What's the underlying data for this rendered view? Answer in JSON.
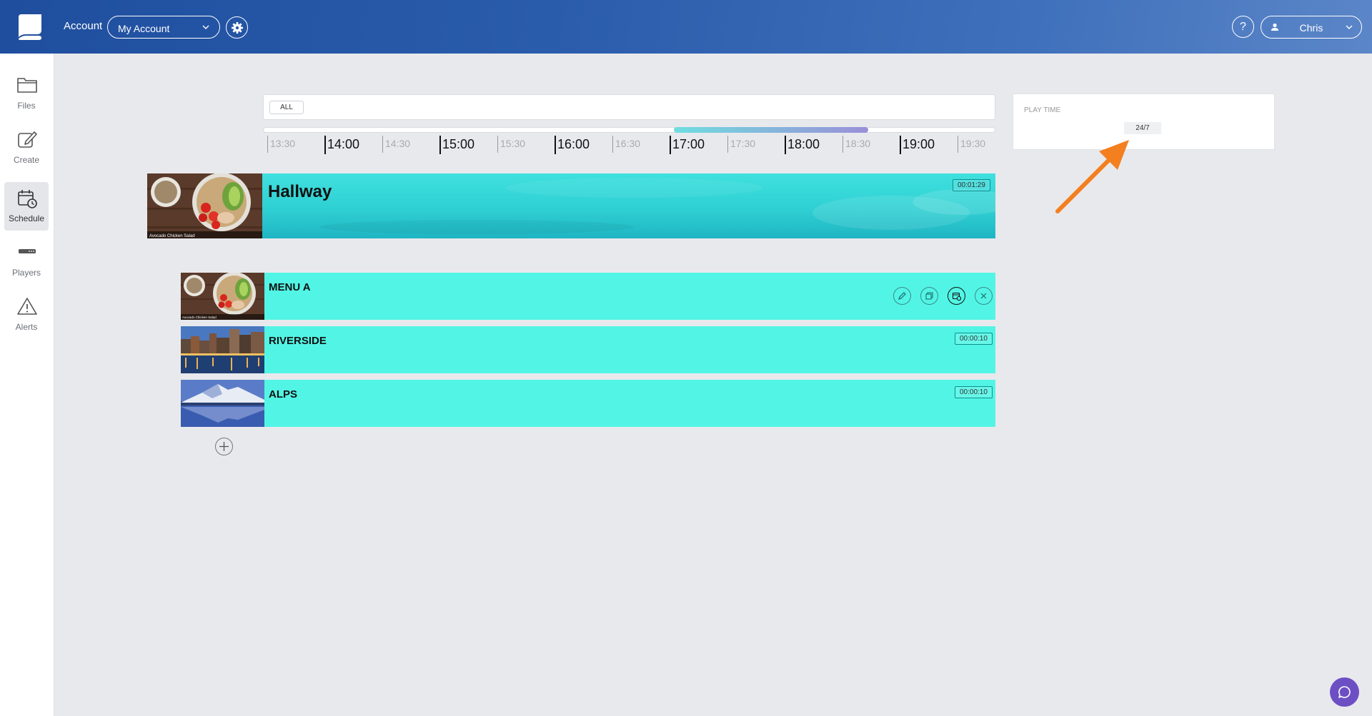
{
  "header": {
    "account_label": "Account",
    "account_select": "My Account",
    "help_label": "?",
    "user_name": "Chris"
  },
  "sidebar": {
    "items": [
      {
        "label": "Files",
        "icon": "folder-icon"
      },
      {
        "label": "Create",
        "icon": "edit-square-icon"
      },
      {
        "label": "Schedule",
        "icon": "calendar-clock-icon",
        "active": true
      },
      {
        "label": "Players",
        "icon": "player-device-icon"
      },
      {
        "label": "Alerts",
        "icon": "warning-icon"
      }
    ]
  },
  "filter": {
    "chip": "ALL"
  },
  "timeline": {
    "ticks": [
      "13:30",
      "14:00",
      "14:30",
      "15:00",
      "15:30",
      "16:00",
      "16:30",
      "17:00",
      "17:30",
      "18:00",
      "18:30",
      "19:00",
      "19:30"
    ],
    "selected_range": [
      "17:00",
      "18:25"
    ]
  },
  "play_time": {
    "label": "PLAY TIME",
    "value": "24/7"
  },
  "playlist": {
    "title": "Hallway",
    "duration": "00:01:29",
    "thumb_caption": "Avocado Chicken Salad",
    "items": [
      {
        "title": "MENU A",
        "duration": "",
        "thumb": "salad",
        "thumb_caption": "Avocado Chicken Salad"
      },
      {
        "title": "RIVERSIDE",
        "duration": "00:00:10",
        "thumb": "city-river"
      },
      {
        "title": "ALPS",
        "duration": "00:00:10",
        "thumb": "mountain-lake"
      }
    ]
  },
  "colors": {
    "header": "#2a5cac",
    "playlist_bar": "#2fd0d3",
    "item_bar": "#52f5e5",
    "highlight_arrow": "#f47f1f",
    "chat": "#6d4fc4"
  }
}
